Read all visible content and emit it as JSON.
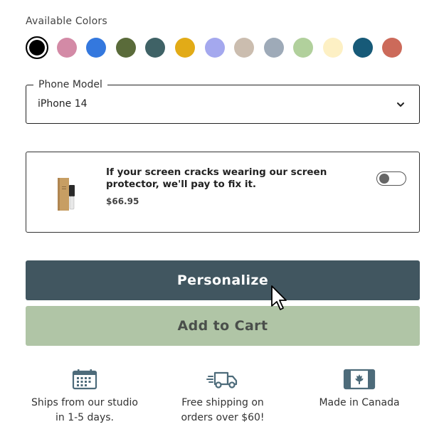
{
  "colors": {
    "label": "Available Colors",
    "swatches": [
      {
        "name": "black",
        "hex": "#000000",
        "selected": true
      },
      {
        "name": "pink",
        "hex": "#d38aa6"
      },
      {
        "name": "blue",
        "hex": "#3478de"
      },
      {
        "name": "olive",
        "hex": "#5a6b3a"
      },
      {
        "name": "slate-teal",
        "hex": "#3f6266"
      },
      {
        "name": "mustard",
        "hex": "#e2ab17"
      },
      {
        "name": "periwinkle",
        "hex": "#a4a8ee"
      },
      {
        "name": "taupe",
        "hex": "#cbbdaf"
      },
      {
        "name": "blue-grey",
        "hex": "#9eaab8"
      },
      {
        "name": "sage",
        "hex": "#b1d09c"
      },
      {
        "name": "cream",
        "hex": "#fdf0c4"
      },
      {
        "name": "deep-teal",
        "hex": "#175a78"
      },
      {
        "name": "terracotta",
        "hex": "#cc6a5a"
      }
    ]
  },
  "phone_model": {
    "label": "Phone Model",
    "value": "iPhone 14"
  },
  "protector": {
    "text": "If your screen cracks wearing our screen protector, we'll pay to fix it.",
    "price": "$66.95",
    "toggle_on": false
  },
  "buttons": {
    "personalize": "Personalize",
    "add_to_cart": "Add to Cart"
  },
  "perks": [
    {
      "icon": "calendar-icon",
      "line1": "Ships from our studio",
      "line2": "in 1-5 days."
    },
    {
      "icon": "truck-icon",
      "line1": "Free shipping on",
      "line2": "orders over $60!"
    },
    {
      "icon": "canada-flag-icon",
      "line1": "Made in Canada",
      "line2": ""
    }
  ],
  "theme": {
    "primary": "#415660",
    "secondary": "#b0c5a6",
    "icon_color": "#4d6b7a"
  }
}
